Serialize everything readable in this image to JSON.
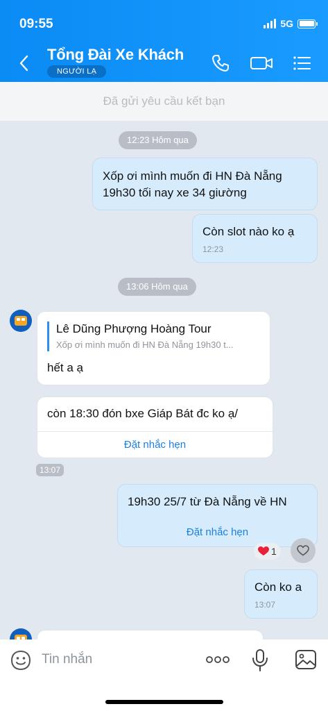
{
  "status": {
    "time": "09:55",
    "network": "5G"
  },
  "header": {
    "title": "Tổng Đài Xe Khách",
    "badge": "NGƯỜI LẠ"
  },
  "friend_request": "Đã gửi yêu cầu kết bạn",
  "messages": {
    "chip1": "12:23 Hôm qua",
    "m1": "Xốp ơi mình muốn đi HN Đà Nẵng 19h30 tối nay xe 34 giường",
    "m2": "Còn slot nào ko ạ",
    "m2_time": "12:23",
    "chip2": "13:06 Hôm qua",
    "m3_quote_name": "Lê Dũng Phượng Hoàng Tour",
    "m3_quote_text": "Xốp ơi mình muốn đi HN Đà Nẵng 19h30 t...",
    "m3": "hết a ạ",
    "m4": "còn 18:30 đón bxe Giáp Bát đc ko ạ/",
    "m4_action": "Đặt nhắc hẹn",
    "m4_time": "13:07",
    "m5": "19h30 25/7 từ Đà Nẵng về HN",
    "m5_action": "Đặt nhắc hẹn",
    "m5_reaction_count": "1",
    "m6": "Còn ko a",
    "m6_time": "13:07"
  },
  "input": {
    "placeholder": "Tin nhắn"
  },
  "icons": [
    "back-icon",
    "phone-icon",
    "video-icon",
    "menu-icon",
    "sticker-icon",
    "more-icon",
    "mic-icon",
    "image-icon",
    "heart-icon"
  ],
  "colors": {
    "header": "#1a9bff",
    "outgoing_bubble": "#d6ecfd",
    "incoming_bubble": "#ffffff",
    "link": "#1a7fe0",
    "background": "#e2e8f0"
  }
}
